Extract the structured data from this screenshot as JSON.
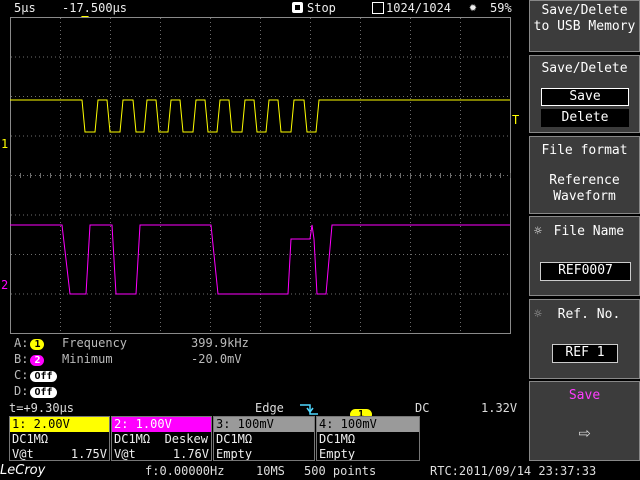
{
  "status": {
    "timebase": "5µs",
    "trigger_delay": "-17.500µs",
    "stop_label": "Stop",
    "memory_count": "1024/1024",
    "battery": "59%"
  },
  "right_panel": {
    "usb_title": "Save/Delete to USB Memory",
    "save_delete_title": "Save/Delete",
    "save_option": "Save",
    "delete_option": "Delete",
    "file_format_title": "File format",
    "file_format_value": "Reference Waveform",
    "file_name_title": "File Name",
    "file_name_value": "REF0007",
    "ref_no_title": "Ref. No.",
    "ref_no_value": "REF 1",
    "save_button": "Save"
  },
  "markers": {
    "ch1": "1",
    "ch2": "2",
    "trigger": "T"
  },
  "measurements": [
    {
      "slot": "A:",
      "channel": "1",
      "name": "Frequency",
      "value": "399.9kHz",
      "color": "#ffff00"
    },
    {
      "slot": "B:",
      "channel": "2",
      "name": "Minimum",
      "value": "-20.0mV",
      "color": "#ff00ff"
    },
    {
      "slot": "C:",
      "channel": "Off",
      "name": "",
      "value": "",
      "color": "#ffffff"
    },
    {
      "slot": "D:",
      "channel": "Off",
      "name": "",
      "value": "",
      "color": "#ffffff"
    }
  ],
  "trigger_info": {
    "position": "t=+9.30µs",
    "type": "Edge",
    "source": "1",
    "coupling": "DC",
    "level": "1.32V"
  },
  "channels": [
    {
      "header": "1: 2.00V",
      "line1": "DC1MΩ",
      "line2a": "V@t",
      "line2b": "1.75V",
      "color": "#ffff00",
      "text": "#000"
    },
    {
      "header": "2: 1.00V",
      "line1": "DC1MΩ  Deskew",
      "line2a": "V@t",
      "line2b": "1.76V",
      "color": "#ff00ff",
      "text": "#fff"
    },
    {
      "header": "3: 100mV",
      "line1": "DC1MΩ",
      "line2a": "Empty",
      "line2b": "",
      "color": "#9a9a9a",
      "text": "#000"
    },
    {
      "header": "4: 100mV",
      "line1": "DC1MΩ",
      "line2a": "Empty",
      "line2b": "",
      "color": "#9a9a9a",
      "text": "#000"
    }
  ],
  "bottom": {
    "brand": "LeCroy",
    "frequency": "f:0.00000Hz",
    "sample_rate": "10MS",
    "points": "500 points",
    "rtc": "RTC:2011/09/14 23:37:33"
  },
  "colors": {
    "ch1": "#ffff00",
    "ch2": "#ff00ff",
    "grid": "#7a7a7a",
    "panel": "#3c3c3c",
    "save_label": "#ff3cff"
  },
  "icons": {
    "stop": "stop-icon",
    "memory": "memory-icon",
    "battery": "brightness-icon",
    "file_name": "knob-icon",
    "ref_no": "knob-icon",
    "save": "save-arrow-icon"
  }
}
